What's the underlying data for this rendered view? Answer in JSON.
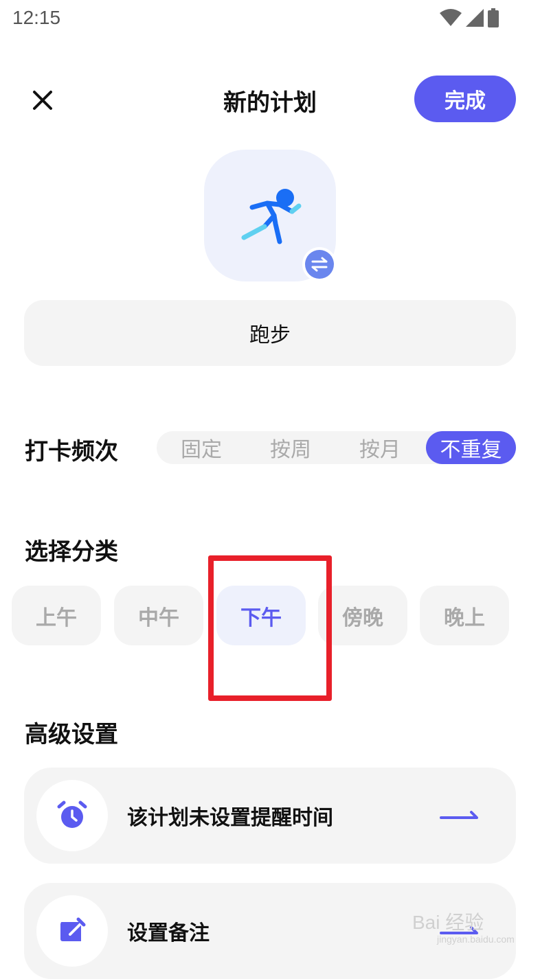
{
  "status_bar": {
    "time": "12:15"
  },
  "header": {
    "title": "新的计划",
    "done_label": "完成"
  },
  "plan": {
    "name": "跑步",
    "icon": "running-person-icon"
  },
  "frequency": {
    "label": "打卡频次",
    "options": [
      "固定",
      "按周",
      "按月",
      "不重复"
    ],
    "selected": "不重复"
  },
  "category": {
    "label": "选择分类",
    "options": [
      "上午",
      "中午",
      "下午",
      "傍晚",
      "晚上"
    ],
    "selected": "下午"
  },
  "advanced": {
    "label": "高级设置",
    "items": [
      {
        "text": "该计划未设置提醒时间",
        "icon": "alarm-clock-icon"
      },
      {
        "text": "设置备注",
        "icon": "edit-note-icon"
      }
    ]
  },
  "watermark": {
    "brand": "Bai 经验",
    "url": "jingyan.baidu.com"
  },
  "colors": {
    "accent": "#5b5bf0",
    "chip_bg": "#f4f4f4",
    "highlight": "#e8202a"
  }
}
